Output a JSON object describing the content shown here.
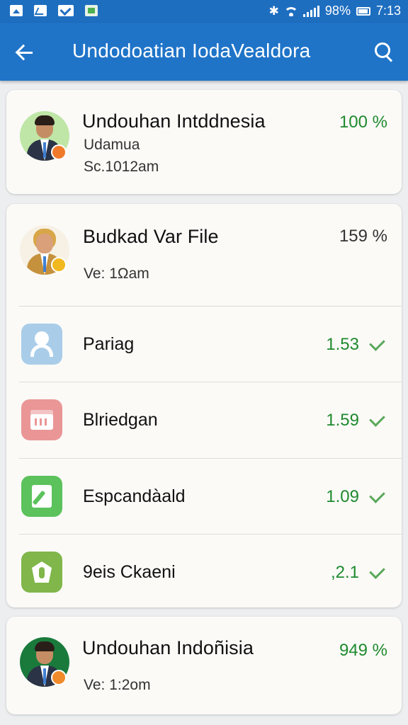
{
  "status_bar": {
    "battery": "98%",
    "time": "7:13",
    "icons": [
      "photo-icon",
      "chart-icon",
      "mail-icon",
      "app-notification-icon",
      "bluetooth-icon",
      "wifi-icon",
      "signal-icon",
      "battery-icon"
    ]
  },
  "app_bar": {
    "title": "Undodoatian IodaVealdora",
    "back_icon": "arrow-back-icon",
    "search_icon": "search-icon"
  },
  "top_card": {
    "title": "Undouhan Intddnesia",
    "line1": "Udamua",
    "line2": "Sc.1012am",
    "percent": "100 %"
  },
  "file_card": {
    "title": "Budkad Var File",
    "version": "Ve: 1Ωam",
    "percent": "159 %",
    "items": [
      {
        "label": "Pariag",
        "value": "1.53",
        "icon": "person-icon"
      },
      {
        "label": "Blriedgan",
        "value": "1.59",
        "icon": "calendar-icon"
      },
      {
        "label": "Espcandàald",
        "value": "1.09",
        "icon": "edit-icon"
      },
      {
        "label": "9eis Ckaeni",
        "value": ",2.1",
        "icon": "leaf-icon"
      }
    ]
  },
  "bottom_card": {
    "title": "Undouhan Indoñisia",
    "version": "Ve: 1:2om",
    "percent": "949 %"
  },
  "colors": {
    "primary": "#1f74c8",
    "status_bar": "#1e6ec0",
    "success_green": "#1f8a2e",
    "card_background": "#fbfaf7",
    "page_background": "#eceef0"
  }
}
